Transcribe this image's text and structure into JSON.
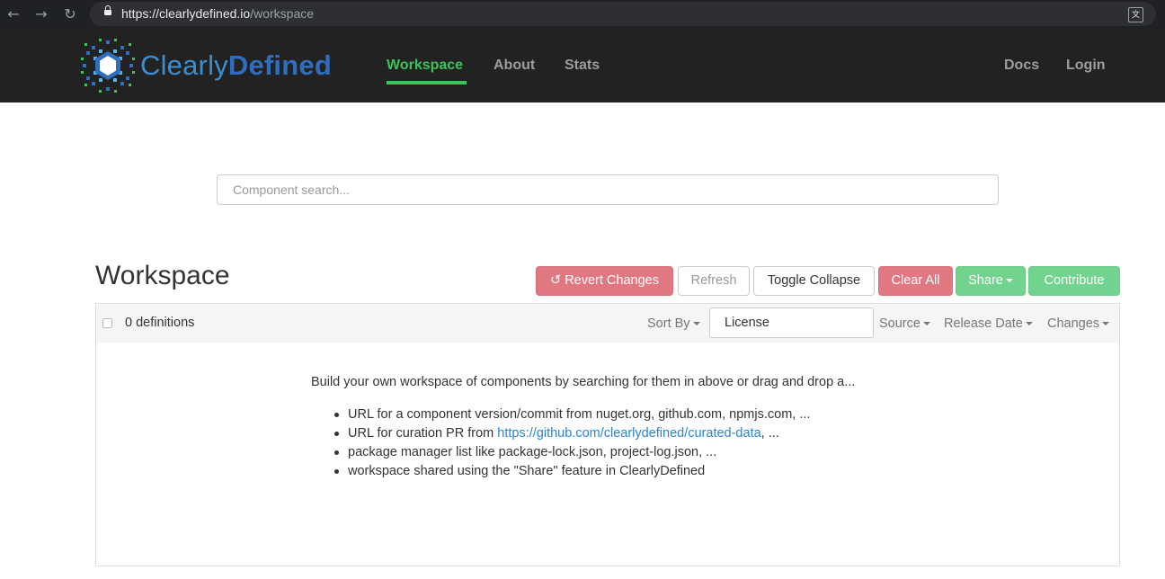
{
  "browser": {
    "url_host": "https://clearlydefined.io",
    "url_path": "/workspace",
    "translate_icon": "translate-icon"
  },
  "brand": {
    "name_part1": "Clearly",
    "name_part2": "Defined",
    "colors": {
      "accent_green": "#3cc35c",
      "header_bg": "#222222",
      "danger": "#e07882",
      "success": "#72d38e",
      "link": "#2a84d2",
      "brand_blue": "#2f6ebd"
    }
  },
  "nav": {
    "workspace": "Workspace",
    "about": "About",
    "stats": "Stats",
    "docs": "Docs",
    "login": "Login"
  },
  "search": {
    "placeholder": "Component search..."
  },
  "workspace": {
    "title": "Workspace",
    "buttons": {
      "revert": "Revert Changes",
      "refresh": "Refresh",
      "toggle_collapse": "Toggle Collapse",
      "clear_all": "Clear All",
      "share": "Share",
      "contribute": "Contribute"
    }
  },
  "definitions": {
    "count_label": "0 definitions",
    "sort_by": "Sort By",
    "license_value": "License",
    "filters": {
      "source": "Source",
      "release_date": "Release Date",
      "changes": "Changes"
    },
    "intro": "Build your own workspace of components by searching for them in above or drag and drop a...",
    "tips": {
      "t1": "URL for a component version/commit from nuget.org, github.com, npmjs.com, ...",
      "t2_before": "URL for curation PR from ",
      "t2_link": "https://github.com/clearlydefined/curated-data",
      "t2_after": ", ...",
      "t3": "package manager list like package-lock.json, project-log.json, ...",
      "t4": "workspace shared using the \"Share\" feature in ClearlyDefined"
    }
  }
}
